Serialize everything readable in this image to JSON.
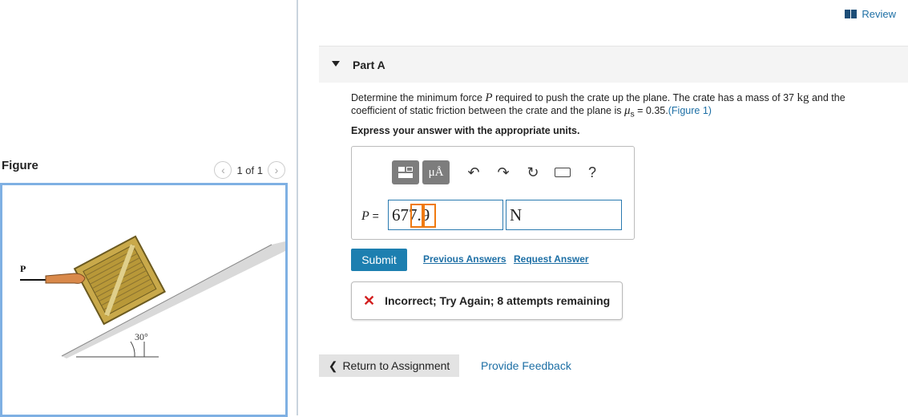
{
  "header": {
    "review_label": "Review"
  },
  "figure": {
    "title": "Figure",
    "pager_text": "1 of 1",
    "load_label": "P",
    "angle_label": "30°"
  },
  "part": {
    "title": "Part A"
  },
  "question": {
    "text_before": "Determine the minimum force ",
    "force_var": "P",
    "text_middle": " required to push the crate up the plane. The crate has a mass of 37 ",
    "mass_unit": "kg",
    "text_after": " and the coefficient of static friction between the crate and the plane is ",
    "mu_var": "μ",
    "mu_sub": "s",
    "mu_value": " = 0.35.",
    "figure_link": "(Figure 1)",
    "instruction": "Express your answer with the appropriate units."
  },
  "answer": {
    "var_label": "P",
    "equals": "=",
    "value": "677.9",
    "unit": "N"
  },
  "toolbar": {
    "units_label": "μÅ",
    "help_label": "?"
  },
  "actions": {
    "submit_label": "Submit",
    "previous_answers": "Previous Answers",
    "request_answer": "Request Answer"
  },
  "feedback": {
    "text": "Incorrect; Try Again; 8 attempts remaining"
  },
  "footer": {
    "return_label": "Return to Assignment",
    "provide_feedback": "Provide Feedback"
  },
  "colors": {
    "accent": "#1d7fb0",
    "link": "#1d6fa5",
    "error": "#d32020",
    "highlight": "#f07a10"
  }
}
